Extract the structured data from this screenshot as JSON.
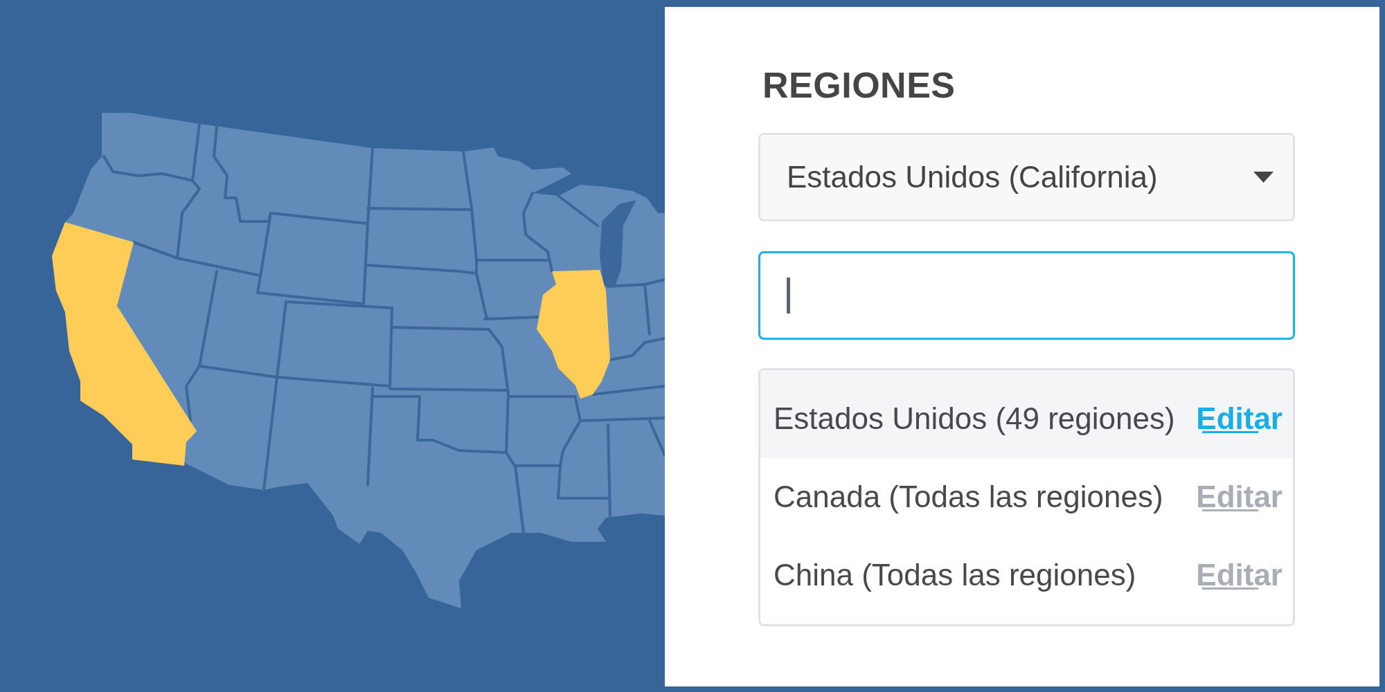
{
  "map": {
    "states": [
      {
        "selected": true
      },
      {
        "selected": true
      }
    ]
  },
  "panel": {
    "title": "REGIONES",
    "dropdown": {
      "value": "Estados Unidos (California)"
    },
    "search_field": {
      "focused": true
    },
    "list": {
      "rows": [
        {
          "label": "Estados Unidos (49 regiones)",
          "action": "Editar",
          "selected": true
        },
        {
          "label": "Canada (Todas las regiones)",
          "action": "Editar",
          "selected": false
        },
        {
          "label": "China (Todas las regiones)",
          "action": "Editar",
          "selected": false
        }
      ]
    }
  }
}
